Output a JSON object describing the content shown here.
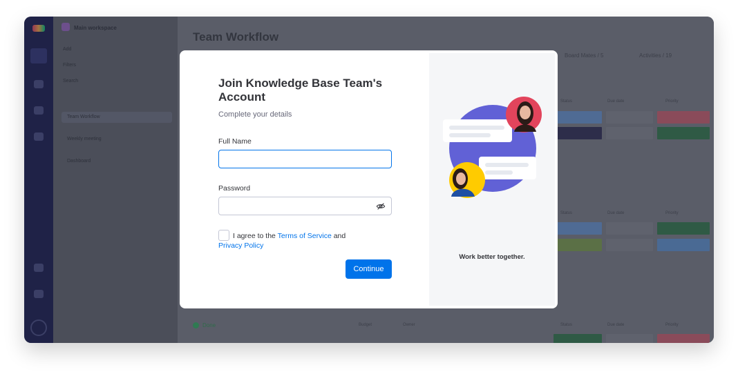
{
  "background_app": {
    "workspace": "Main workspace",
    "nav_items": [
      "Add",
      "Filters",
      "Search"
    ],
    "boards": [
      "Team Workflow",
      "Weekly meeting",
      "Dashboard"
    ],
    "board_title": "Team Workflow",
    "toolbar": [
      "Board Mates / 5",
      "Activities / 19"
    ],
    "column_headers": [
      "Status",
      "Due date",
      "Priority"
    ],
    "group_name": "Done",
    "bottom_headers": [
      "Budget",
      "Owner",
      "Status",
      "Due date",
      "Priority"
    ]
  },
  "modal": {
    "title": "Join Knowledge Base Team's Account",
    "subtitle": "Complete your details",
    "full_name": {
      "label": "Full Name",
      "value": "",
      "placeholder": ""
    },
    "password": {
      "label": "Password",
      "value": "",
      "placeholder": ""
    },
    "agree": {
      "prefix": "I agree to the ",
      "terms_link": "Terms of Service",
      "middle": " and",
      "privacy_link": "Privacy Policy",
      "checked": false
    },
    "continue_label": "Continue",
    "tagline": "Work better together.",
    "icons": {
      "password_toggle": "eye-off-icon"
    },
    "colors": {
      "accent": "#0073ea",
      "illustration_circle": "#6161d6",
      "avatar_red": "#e2445c",
      "avatar_yellow": "#ffcb00"
    }
  }
}
